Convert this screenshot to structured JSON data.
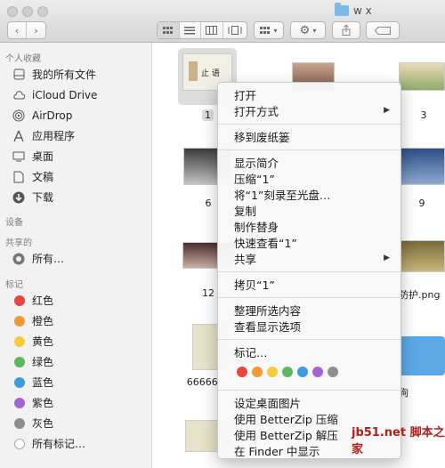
{
  "window": {
    "title": "w x"
  },
  "toolbar": {
    "back": "‹",
    "forward": "›"
  },
  "sidebar": {
    "favorites_header": "个人收藏",
    "favorites": [
      {
        "label": "我的所有文件",
        "icon": "all-files-icon"
      },
      {
        "label": "iCloud Drive",
        "icon": "cloud-icon"
      },
      {
        "label": "AirDrop",
        "icon": "airdrop-icon"
      },
      {
        "label": "应用程序",
        "icon": "applications-icon"
      },
      {
        "label": "桌面",
        "icon": "desktop-icon"
      },
      {
        "label": "文稿",
        "icon": "documents-icon"
      },
      {
        "label": "下载",
        "icon": "downloads-icon"
      }
    ],
    "devices_header": "设备",
    "shared_header": "共享的",
    "shared": [
      {
        "label": "所有…",
        "icon": "network-icon"
      }
    ],
    "tags_header": "标记",
    "tags": [
      {
        "label": "红色",
        "color": "#e8453c"
      },
      {
        "label": "橙色",
        "color": "#f09a37"
      },
      {
        "label": "黄色",
        "color": "#f5cc3a"
      },
      {
        "label": "绿色",
        "color": "#5cb85c"
      },
      {
        "label": "蓝色",
        "color": "#3e9be0"
      },
      {
        "label": "紫色",
        "color": "#a565cf"
      },
      {
        "label": "灰色",
        "color": "#8e8e8e"
      }
    ],
    "all_tags": "所有标记…"
  },
  "content": {
    "files": [
      {
        "label": "1"
      },
      {
        "label": "3"
      },
      {
        "label": "6"
      },
      {
        "label": "9"
      },
      {
        "label": "12"
      },
      {
        "label": "防护.png"
      },
      {
        "label": "66666."
      },
      {
        "label": "狗"
      }
    ],
    "thumb_text": "止 语"
  },
  "menu": {
    "items_1": [
      "打开",
      "打开方式"
    ],
    "items_2": [
      "移到废纸篓"
    ],
    "items_3": [
      "显示简介",
      "压缩“1”",
      "将“1”刻录至光盘…",
      "复制",
      "制作替身",
      "快速查看“1”",
      "共享"
    ],
    "items_4": [
      "拷贝“1”"
    ],
    "items_5": [
      "整理所选内容",
      "查看显示选项"
    ],
    "tags_label": "标记…",
    "tag_colors": [
      "#e8453c",
      "#f09a37",
      "#f5cc3a",
      "#5cb85c",
      "#3e9be0",
      "#a565cf",
      "#8e8e8e"
    ],
    "items_6": [
      "设定桌面图片",
      "使用 BetterZip 压缩",
      "使用 BetterZip 解压",
      "在 Finder 中显示"
    ]
  },
  "watermark": "jb51.net 脚本之家"
}
